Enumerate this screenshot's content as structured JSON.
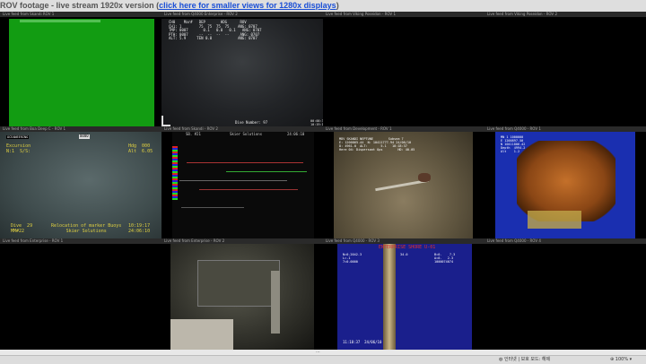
{
  "page": {
    "title_prefix": "ROV footage - live stream 1920x version (",
    "title_link": "click here for smaller views for 1280x displays",
    "title_suffix": ")"
  },
  "cells": [
    {
      "caption": "Live feed from Skandi ROV 1",
      "type": "green"
    },
    {
      "caption": "Live feed from Q4000 Enterprise - ROV 2",
      "type": "sensor"
    },
    {
      "caption": "Live feed from Viking Poseidon - ROV 1",
      "type": "black"
    },
    {
      "caption": "Live feed from Viking Poseidon - ROV 2",
      "type": "black"
    },
    {
      "caption": "Live feed from Boa Deep C - ROV 1",
      "type": "boa"
    },
    {
      "caption": "Live feed from Skandi - ROV 2",
      "type": "skandi"
    },
    {
      "caption": "Live feed from Development - ROV 1",
      "type": "neptune"
    },
    {
      "caption": "Live feed from Q4000 - ROV 1",
      "type": "orange"
    },
    {
      "caption": "Live feed from Enterprise - ROV 1",
      "type": "black"
    },
    {
      "caption": "Live feed from Enterprise - ROV 2",
      "type": "machinery"
    },
    {
      "caption": "Live feed from Q4000 - ROV 3",
      "type": "pipe"
    },
    {
      "caption": "Live feed from Q4000 - ROV 4",
      "type": "black"
    }
  ],
  "sensor_overlay": {
    "text": "CH0    Mar#   DEP       HDG      ROV\nCH1: 1        75  75  75  75    ANG: 0707\nTMP: 0007       0.1   0.0   0.1   ANG: 0707\nPTH: 0007     --  --  --  --     ANG: 0707\nALT: 5.9     TEN 0.0            ANG: 0707",
    "bottom": "Dive Number: 97",
    "time": "00:00:31\n10:19:17"
  },
  "boa_overlay": {
    "tag": "OCEANEERING",
    "center_tag": "0000",
    "left": "Excursion\nN:1  S/S:",
    "right": "Hdg  000\nAlt  6.05",
    "bottom_left": "Dive  29\nMM#22",
    "bottom_center": "Relocation of marker Buoys\nSkier Solutions",
    "bottom_right": "10:19:17\n24:06:10"
  },
  "skandi_overlay": {
    "top_left": "SB. #21",
    "top_center": "Skier Solutions",
    "top_right": "24:06:10"
  },
  "neptune_overlay": {
    "text": "MDV SKANDI NEPTUNE        Subsea 7\nE: 1200865.44  N: 10411777.94 24/06/10\nD: 4961.0  ALT:       5.1   10:18:37\nHere 04: Dispersant Ops        HD: 40.05"
  },
  "orange_overlay": {
    "text": "MN 1 1000000\nE 1200897.50\nN 10411806.42\nDepth  4994.2\nAlt    1.2"
  },
  "pipe_overlay": {
    "title": "ENTERPRISE SHORE U-01",
    "left": "N=0.2042.3\nL=.1\n7=0.0000",
    "center": "34.0",
    "right": "B=0.    7.3\nA=0.   2.3\n1000074074",
    "bottom": "11:18:37  24/06/10"
  },
  "status_bar": {
    "mode": "인터넷 | 보호 모드: 해제",
    "zoom": "100%"
  }
}
